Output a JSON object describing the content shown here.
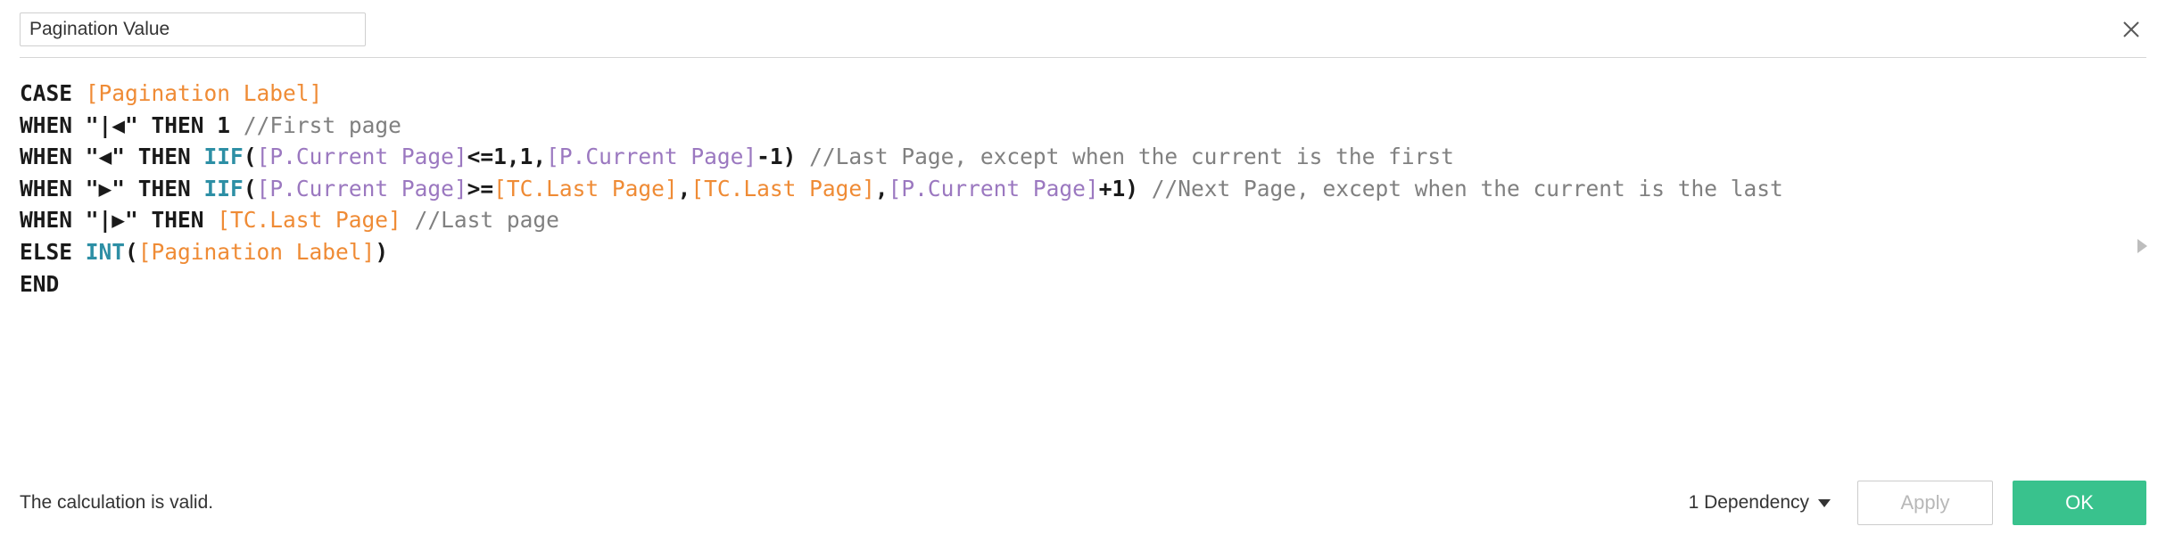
{
  "header": {
    "calc_name_value": "Pagination Value",
    "calc_name_placeholder": "Calculation name",
    "close_icon": "close-icon"
  },
  "formula": {
    "lines": [
      {
        "tokens": [
          {
            "t": "CASE ",
            "c": "kw"
          },
          {
            "t": "[Pagination Label]",
            "c": "fld"
          }
        ]
      },
      {
        "tokens": [
          {
            "t": "WHEN ",
            "c": "kw"
          },
          {
            "t": "\"|◀\" ",
            "c": "str"
          },
          {
            "t": "THEN ",
            "c": "kw"
          },
          {
            "t": "1 ",
            "c": "num"
          },
          {
            "t": "//First page",
            "c": "cmt"
          }
        ]
      },
      {
        "tokens": [
          {
            "t": "WHEN ",
            "c": "kw"
          },
          {
            "t": "\"◀\" ",
            "c": "str"
          },
          {
            "t": "THEN ",
            "c": "kw"
          },
          {
            "t": "IIF",
            "c": "fn"
          },
          {
            "t": "(",
            "c": "op"
          },
          {
            "t": "[P.Current Page]",
            "c": "prm"
          },
          {
            "t": "<=1,1,",
            "c": "op"
          },
          {
            "t": "[P.Current Page]",
            "c": "prm"
          },
          {
            "t": "-1) ",
            "c": "op"
          },
          {
            "t": "//Last Page, except when the current is the first",
            "c": "cmt"
          }
        ]
      },
      {
        "tokens": [
          {
            "t": "WHEN ",
            "c": "kw"
          },
          {
            "t": "\"▶\" ",
            "c": "str"
          },
          {
            "t": "THEN ",
            "c": "kw"
          },
          {
            "t": "IIF",
            "c": "fn"
          },
          {
            "t": "(",
            "c": "op"
          },
          {
            "t": "[P.Current Page]",
            "c": "prm"
          },
          {
            "t": ">=",
            "c": "op"
          },
          {
            "t": "[TC.Last Page]",
            "c": "fld"
          },
          {
            "t": ",",
            "c": "op"
          },
          {
            "t": "[TC.Last Page]",
            "c": "fld"
          },
          {
            "t": ",",
            "c": "op"
          },
          {
            "t": "[P.Current Page]",
            "c": "prm"
          },
          {
            "t": "+1) ",
            "c": "op"
          },
          {
            "t": "//Next Page, except when the current is the last",
            "c": "cmt"
          }
        ]
      },
      {
        "tokens": [
          {
            "t": "WHEN ",
            "c": "kw"
          },
          {
            "t": "\"|▶\" ",
            "c": "str"
          },
          {
            "t": "THEN ",
            "c": "kw"
          },
          {
            "t": "[TC.Last Page]",
            "c": "fld"
          },
          {
            "t": " ",
            "c": "op"
          },
          {
            "t": "//Last page",
            "c": "cmt"
          }
        ]
      },
      {
        "tokens": [
          {
            "t": "ELSE ",
            "c": "kw"
          },
          {
            "t": "INT",
            "c": "fn"
          },
          {
            "t": "(",
            "c": "op"
          },
          {
            "t": "[Pagination Label]",
            "c": "fld"
          },
          {
            "t": ")",
            "c": "op"
          }
        ]
      },
      {
        "tokens": [
          {
            "t": "END",
            "c": "kw"
          }
        ]
      }
    ],
    "expander_icon": "expand-right-triangle-icon"
  },
  "footer": {
    "status_text": "The calculation is valid.",
    "dependency_label": "1 Dependency",
    "dependency_caret_icon": "chevron-down-icon",
    "apply_label": "Apply",
    "ok_label": "OK"
  },
  "colors": {
    "field_orange": "#ef8b35",
    "parameter_purple": "#9b78c0",
    "function_teal": "#2d8fa5",
    "comment_gray": "#808080",
    "ok_green": "#39c28d",
    "border_gray": "#cfcfcf"
  }
}
